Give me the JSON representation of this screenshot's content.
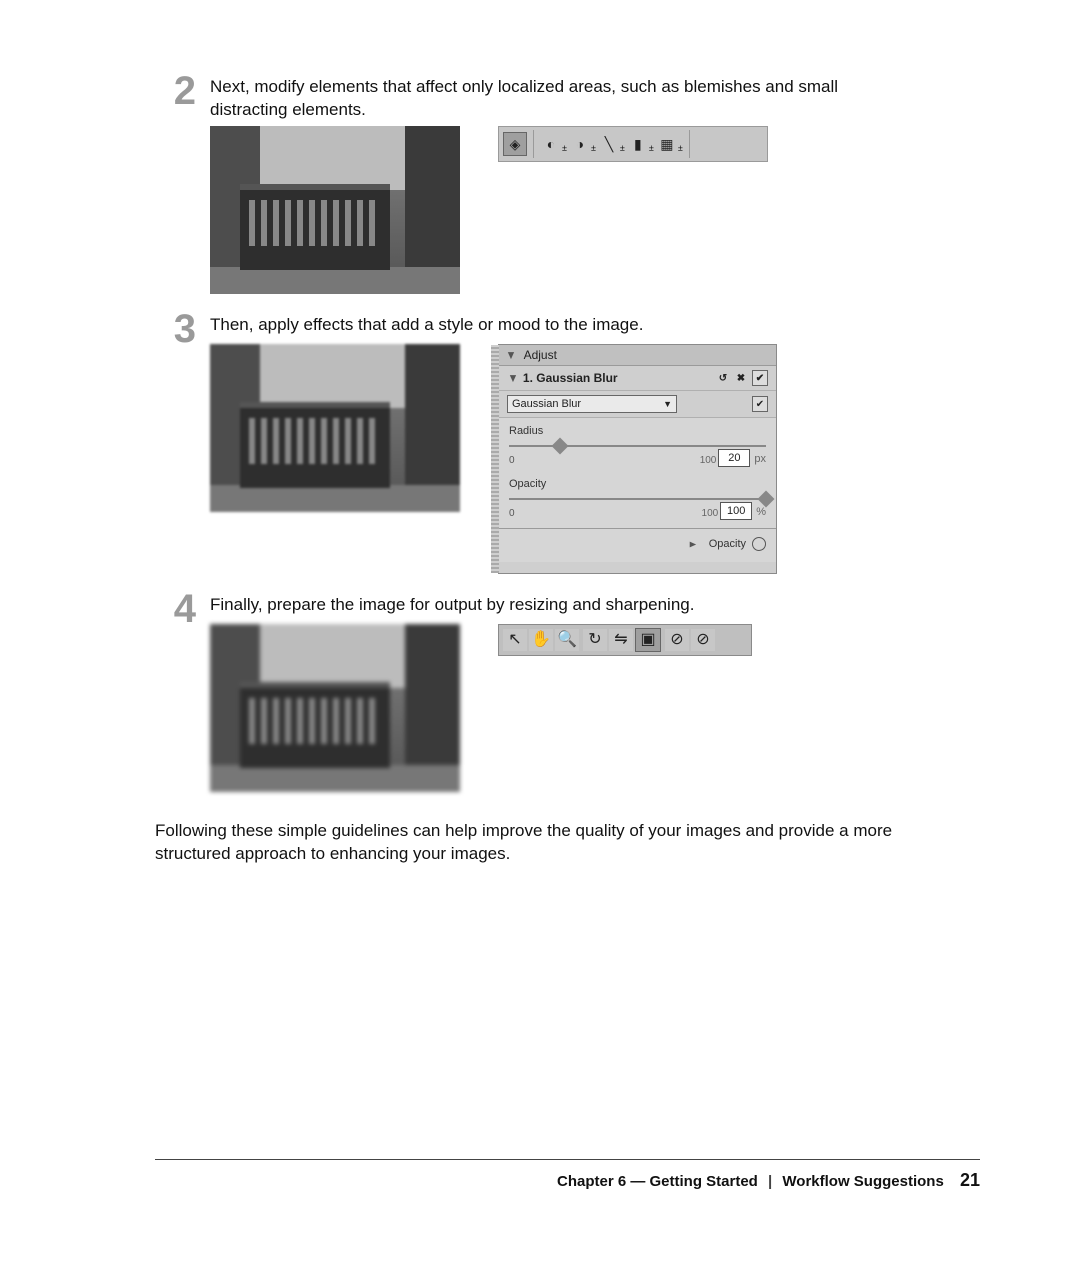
{
  "steps": {
    "s2": {
      "num": "2",
      "text": "Next, modify elements that affect only localized areas, such as blemishes and small distracting elements."
    },
    "s3": {
      "num": "3",
      "text": "Then, apply effects that add a style or mood to the image."
    },
    "s4": {
      "num": "4",
      "text": "Finally, prepare the image for output by resizing and sharpening."
    }
  },
  "toolbar_retouch": {
    "icons": [
      "eye-icon",
      "dodge-icon",
      "sponge-icon",
      "brush-icon",
      "patch-icon",
      "stamp-icon"
    ]
  },
  "adjust_panel": {
    "title": "Adjust",
    "item_title": "1. Gaussian Blur",
    "dropdown": "Gaussian Blur",
    "radius_label": "Radius",
    "radius_min": "0",
    "radius_max": "100",
    "radius_value": "20",
    "radius_unit": "px",
    "opacity_label": "Opacity",
    "opacity_min": "0",
    "opacity_max": "100",
    "opacity_value": "100",
    "opacity_unit": "%",
    "opacity_row": "Opacity"
  },
  "toolbar_output": {
    "icons": [
      "arrow-nw-icon",
      "hand-icon",
      "zoom-icon",
      "rotate-icon",
      "flip-icon",
      "crop-icon",
      "nodrop-icon",
      "nodrop2-icon"
    ]
  },
  "closing": "Following these simple guidelines can help improve the quality of your images and provide a more structured approach to enhancing your images.",
  "footer": {
    "chapter": "Chapter 6 — Getting Started",
    "section": "Workflow Suggestions",
    "page": "21"
  }
}
